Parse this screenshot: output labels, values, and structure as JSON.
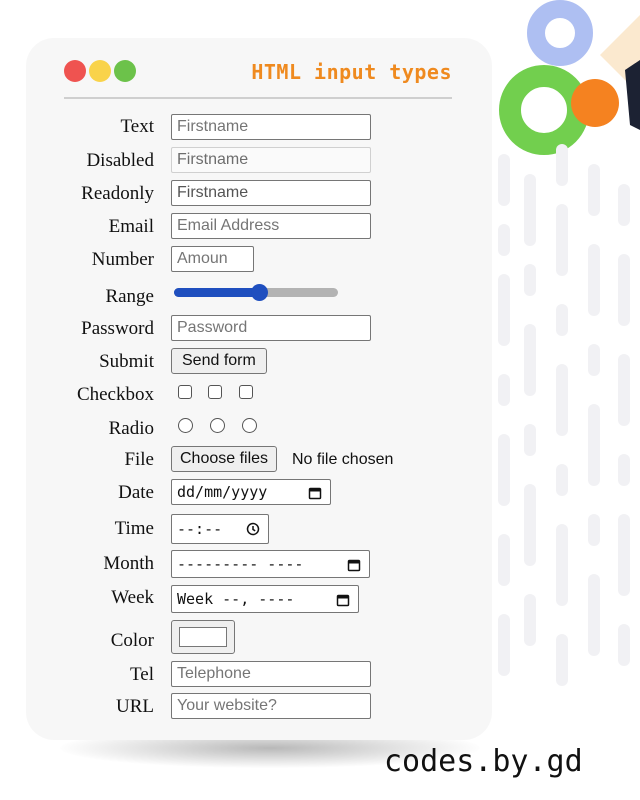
{
  "window": {
    "dots": [
      "#ef5350",
      "#f9d34a",
      "#6cc24a"
    ],
    "title": "HTML input types"
  },
  "fields": {
    "text": {
      "label": "Text",
      "placeholder": "Firstname"
    },
    "disabled": {
      "label": "Disabled",
      "value": "Firstname"
    },
    "readonly": {
      "label": "Readonly",
      "value": "Firstname"
    },
    "email": {
      "label": "Email",
      "placeholder": "Email Address"
    },
    "number": {
      "label": "Number",
      "placeholder": "Amoun"
    },
    "range": {
      "label": "Range",
      "value_fraction": 0.52
    },
    "password": {
      "label": "Password",
      "placeholder": "Password"
    },
    "submit": {
      "label": "Submit",
      "button_label": "Send form"
    },
    "checkbox": {
      "label": "Checkbox",
      "count": 3
    },
    "radio": {
      "label": "Radio",
      "count": 3
    },
    "file": {
      "label": "File",
      "button_label": "Choose files",
      "status": "No file chosen"
    },
    "date": {
      "label": "Date",
      "value": "dd/mm/yyyy"
    },
    "time": {
      "label": "Time",
      "value": "--:--"
    },
    "month": {
      "label": "Month",
      "value": "--------- ----"
    },
    "week": {
      "label": "Week",
      "value": "Week --, ----"
    },
    "color": {
      "label": "Color",
      "value": "#ffffff"
    },
    "tel": {
      "label": "Tel",
      "placeholder": "Telephone"
    },
    "url": {
      "label": "URL",
      "placeholder": "Your website?"
    }
  },
  "brand": "codes.by.gd",
  "colors": {
    "accent_orange": "#ef8a1f",
    "range_fill": "#1f4fbf",
    "deco_blue": "#aebff2",
    "deco_green": "#72cf4e",
    "deco_orange": "#f58220",
    "deco_navy": "#1c2233",
    "deco_cream": "#fbe9cf"
  }
}
